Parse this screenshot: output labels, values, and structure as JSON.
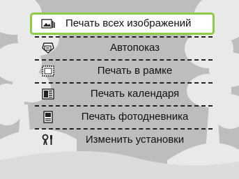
{
  "menu": {
    "items": [
      {
        "label": "Печать всех изображений",
        "icon": "print-all-images-icon",
        "selected": true
      },
      {
        "label": "Автопоказ",
        "icon": "slideshow-icon",
        "selected": false
      },
      {
        "label": "Печать в рамке",
        "icon": "frame-print-icon",
        "selected": false
      },
      {
        "label": "Печать календаря",
        "icon": "calendar-print-icon",
        "selected": false
      },
      {
        "label": "Печать фотодневника",
        "icon": "photo-diary-print-icon",
        "selected": false
      },
      {
        "label": "Изменить установки",
        "icon": "settings-tools-icon",
        "selected": false
      }
    ]
  },
  "colors": {
    "selection_border": "#8fcb44",
    "background_gray": "#bcbcbc",
    "tree_silhouette": "#e6e6e6"
  }
}
